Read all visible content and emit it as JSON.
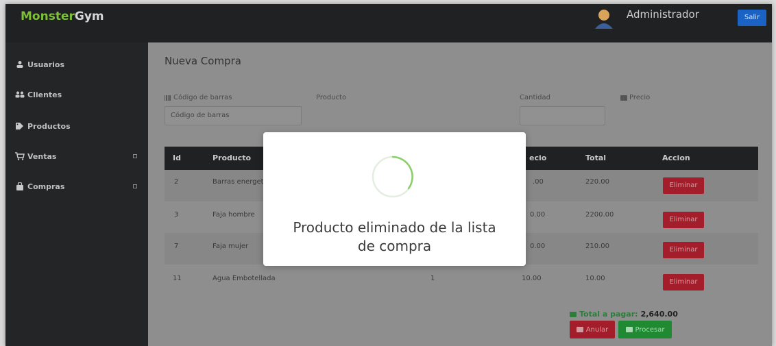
{
  "app": {
    "brand_part1": "Monster",
    "brand_part2": "Gym",
    "user_name": "Administrador",
    "logout_label": "Salir"
  },
  "sidebar": {
    "items": [
      {
        "label": "Usuarios",
        "icon": "user-icon"
      },
      {
        "label": "Clientes",
        "icon": "users-icon"
      },
      {
        "label": "Productos",
        "icon": "tags-icon"
      },
      {
        "label": "Ventas",
        "icon": "cart-icon",
        "has_caret": true
      },
      {
        "label": "Compras",
        "icon": "bag-icon",
        "has_caret": true
      }
    ]
  },
  "page": {
    "title": "Nueva Compra"
  },
  "form": {
    "barcode_label": "Código de barras",
    "barcode_placeholder": "Código de barras",
    "product_label": "Producto",
    "quantity_label": "Cantidad",
    "price_label": "Precio"
  },
  "table": {
    "headers": [
      "Id",
      "Producto",
      "Precio",
      "Total",
      "Accion"
    ],
    "header_precio_visible": "ecio",
    "rows": [
      {
        "id": "2",
        "producto": "Barras energet",
        "cantidad": "",
        "precio": ".00",
        "total": "220.00",
        "action": "Eliminar"
      },
      {
        "id": "3",
        "producto": "Faja hombre",
        "cantidad": "",
        "precio": "0.00",
        "total": "2200.00",
        "action": "Eliminar"
      },
      {
        "id": "7",
        "producto": "Faja mujer",
        "cantidad": "",
        "precio": "0.00",
        "total": "210.00",
        "action": "Eliminar"
      },
      {
        "id": "11",
        "producto": "Agua Embotellada",
        "cantidad": "1",
        "precio": "10.00",
        "total": "10.00",
        "action": "Eliminar"
      }
    ]
  },
  "summary": {
    "total_label": "Total a pagar:",
    "total_value": "2,640.00",
    "cancel_label": "Anular",
    "process_label": "Procesar"
  },
  "modal": {
    "message": "Producto eliminado de la lista de compra"
  },
  "colors": {
    "brand_green": "#7fbf3a",
    "danger": "#a41d2a",
    "success": "#1f8a32",
    "primary": "#1a63c4"
  }
}
